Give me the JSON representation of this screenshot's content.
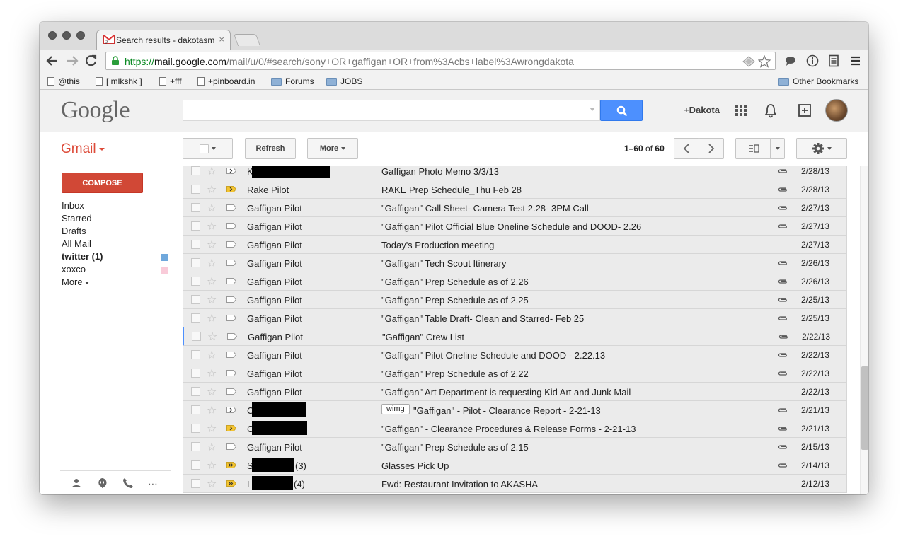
{
  "browser": {
    "tab_title": "Search results - dakotasmi",
    "tab_close": "×",
    "favicon_badge": "0",
    "url_scheme": "https://",
    "url_host": "mail.google.com",
    "url_path": "/mail/u/0/#search/sony+OR+gaffigan+OR+from%3Acbs+label%3Awrongdakota",
    "bookmarks": [
      {
        "label": "@this",
        "kind": "page"
      },
      {
        "label": "[ mlkshk ]",
        "kind": "page"
      },
      {
        "label": "+fff",
        "kind": "page"
      },
      {
        "label": "+pinboard.in",
        "kind": "page"
      },
      {
        "label": "Forums",
        "kind": "folder"
      },
      {
        "label": "JOBS",
        "kind": "folder"
      }
    ],
    "other_bookmarks": "Other Bookmarks"
  },
  "header": {
    "logo": "Google",
    "search_value": "",
    "user_name": "+Dakota"
  },
  "toolbar": {
    "app_label": "Gmail",
    "refresh_label": "Refresh",
    "more_label": "More",
    "pager_range": "1–60",
    "pager_of": "of",
    "pager_total": "60"
  },
  "sidebar": {
    "compose_label": "COMPOSE",
    "items": [
      {
        "label": "Inbox"
      },
      {
        "label": "Starred"
      },
      {
        "label": "Drafts"
      },
      {
        "label": "All Mail"
      },
      {
        "label": "twitter (1)",
        "bold": true,
        "swatch": "#6fa8dc"
      },
      {
        "label": "xoxco",
        "swatch": "#f9cbd9"
      }
    ],
    "more_label": "More"
  },
  "colors": {
    "gmail_red": "#dd4b39",
    "compose_red": "#d14836",
    "search_blue": "#4d90fe",
    "importance_yellow": "#f4c430"
  },
  "messages": [
    {
      "sender": "K",
      "redacted": true,
      "subject": "Gaffigan Photo Memo 3/3/13",
      "attachment": true,
      "date": "2/28/13",
      "importance": "outline-arrow"
    },
    {
      "sender": "Rake Pilot",
      "subject": "RAKE Prep Schedule_Thu Feb 28",
      "attachment": true,
      "date": "2/28/13",
      "importance": "yellow"
    },
    {
      "sender": "Gaffigan Pilot",
      "subject": "\"Gaffigan\" Call Sheet- Camera Test 2.28- 3PM Call",
      "attachment": true,
      "date": "2/27/13",
      "importance": "empty"
    },
    {
      "sender": "Gaffigan Pilot",
      "subject": "\"Gaffigan\" Pilot Official Blue Oneline Schedule and DOOD- 2.26",
      "attachment": true,
      "date": "2/27/13",
      "importance": "empty"
    },
    {
      "sender": "Gaffigan Pilot",
      "subject": "Today's Production meeting",
      "attachment": false,
      "date": "2/27/13",
      "importance": "empty"
    },
    {
      "sender": "Gaffigan Pilot",
      "subject": "\"Gaffigan\" Tech Scout Itinerary",
      "attachment": true,
      "date": "2/26/13",
      "importance": "empty"
    },
    {
      "sender": "Gaffigan Pilot",
      "subject": "\"Gaffigan\" Prep Schedule as of 2.26",
      "attachment": true,
      "date": "2/26/13",
      "importance": "empty"
    },
    {
      "sender": "Gaffigan Pilot",
      "subject": "\"Gaffigan\" Prep Schedule as of 2.25",
      "attachment": true,
      "date": "2/25/13",
      "importance": "empty"
    },
    {
      "sender": "Gaffigan Pilot",
      "subject": "\"Gaffigan\" Table Draft- Clean and Starred- Feb 25",
      "attachment": true,
      "date": "2/25/13",
      "importance": "empty"
    },
    {
      "sender": "Gaffigan Pilot",
      "subject": "\"Gaffigan\" Crew List",
      "attachment": true,
      "date": "2/22/13",
      "importance": "empty",
      "focused": true
    },
    {
      "sender": "Gaffigan Pilot",
      "subject": "\"Gaffigan\" Pilot Oneline Schedule and DOOD - 2.22.13",
      "attachment": true,
      "date": "2/22/13",
      "importance": "empty"
    },
    {
      "sender": "Gaffigan Pilot",
      "subject": "\"Gaffigan\" Prep Schedule as of 2.22",
      "attachment": true,
      "date": "2/22/13",
      "importance": "empty"
    },
    {
      "sender": "Gaffigan Pilot",
      "subject": "\"Gaffigan\" Art Department is requesting Kid Art and Junk Mail",
      "attachment": false,
      "date": "2/22/13",
      "importance": "empty"
    },
    {
      "sender": "C",
      "redacted": true,
      "label": "wimg",
      "subject": "\"Gaffigan\" - Pilot - Clearance Report - 2-21-13",
      "attachment": true,
      "date": "2/21/13",
      "importance": "outline-arrow"
    },
    {
      "sender": "C",
      "redacted": true,
      "subject": "\"Gaffigan\" - Clearance Procedures & Release Forms - 2-21-13",
      "attachment": true,
      "date": "2/21/13",
      "importance": "yellow"
    },
    {
      "sender": "Gaffigan Pilot",
      "subject": "\"Gaffigan\" Prep Schedule as of 2.15",
      "attachment": true,
      "date": "2/15/13",
      "importance": "empty"
    },
    {
      "sender": "S",
      "redacted": true,
      "count": "(3)",
      "subject": "Glasses Pick Up",
      "attachment": true,
      "date": "2/14/13",
      "importance": "yellow-double"
    },
    {
      "sender": "L",
      "redacted": true,
      "count": "(4)",
      "subject": "Fwd: Restaurant Invitation to AKASHA",
      "attachment": false,
      "date": "2/12/13",
      "importance": "yellow-double"
    }
  ]
}
